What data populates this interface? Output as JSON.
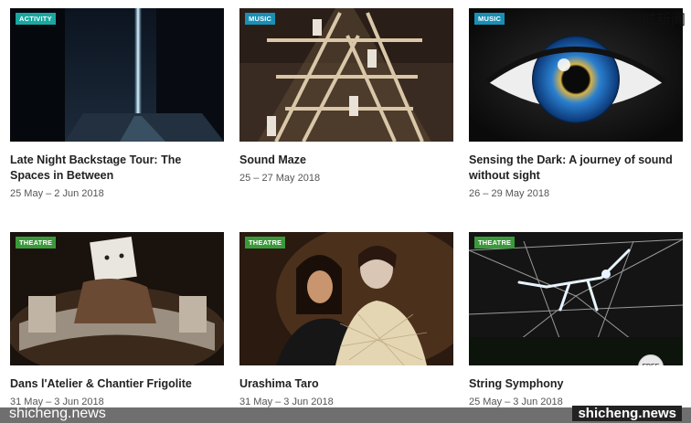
{
  "events": [
    {
      "tag": "ACTIVITY",
      "title": "Late Night Backstage Tour: The Spaces in Between",
      "dates": "25 May – 2 Jun 2018",
      "image": "dark-stage-light-beam"
    },
    {
      "tag": "MUSIC",
      "title": "Sound Maze",
      "dates": "25 – 27 May 2018",
      "image": "wooden-scaffold-structure"
    },
    {
      "tag": "MUSIC",
      "title": "Sensing the Dark: A journey of sound without sight",
      "dates": "26 – 29 May 2018",
      "image": "blue-eye-closeup"
    },
    {
      "tag": "THEATRE",
      "title": "Dans l'Atelier & Chantier Frigolite",
      "dates": "31 May – 3 Jun 2018",
      "image": "box-head-performer"
    },
    {
      "tag": "THEATRE",
      "title": "Urashima Taro",
      "dates": "31 May – 3 Jun 2018",
      "image": "two-women-with-net"
    },
    {
      "tag": "THEATRE",
      "title": "String Symphony",
      "dates": "25 May – 3 Jun 2018",
      "image": "string-figure-rig",
      "badge": "FREE"
    }
  ],
  "watermarks": {
    "top_right": "狮城新闻",
    "bottom_left": "shicheng.news",
    "bottom_right": "shicheng.news"
  },
  "colors": {
    "activity_tag": "#1aa7a0",
    "music_tag": "#1a8fb6",
    "theatre_tag": "#3a9a3a"
  }
}
